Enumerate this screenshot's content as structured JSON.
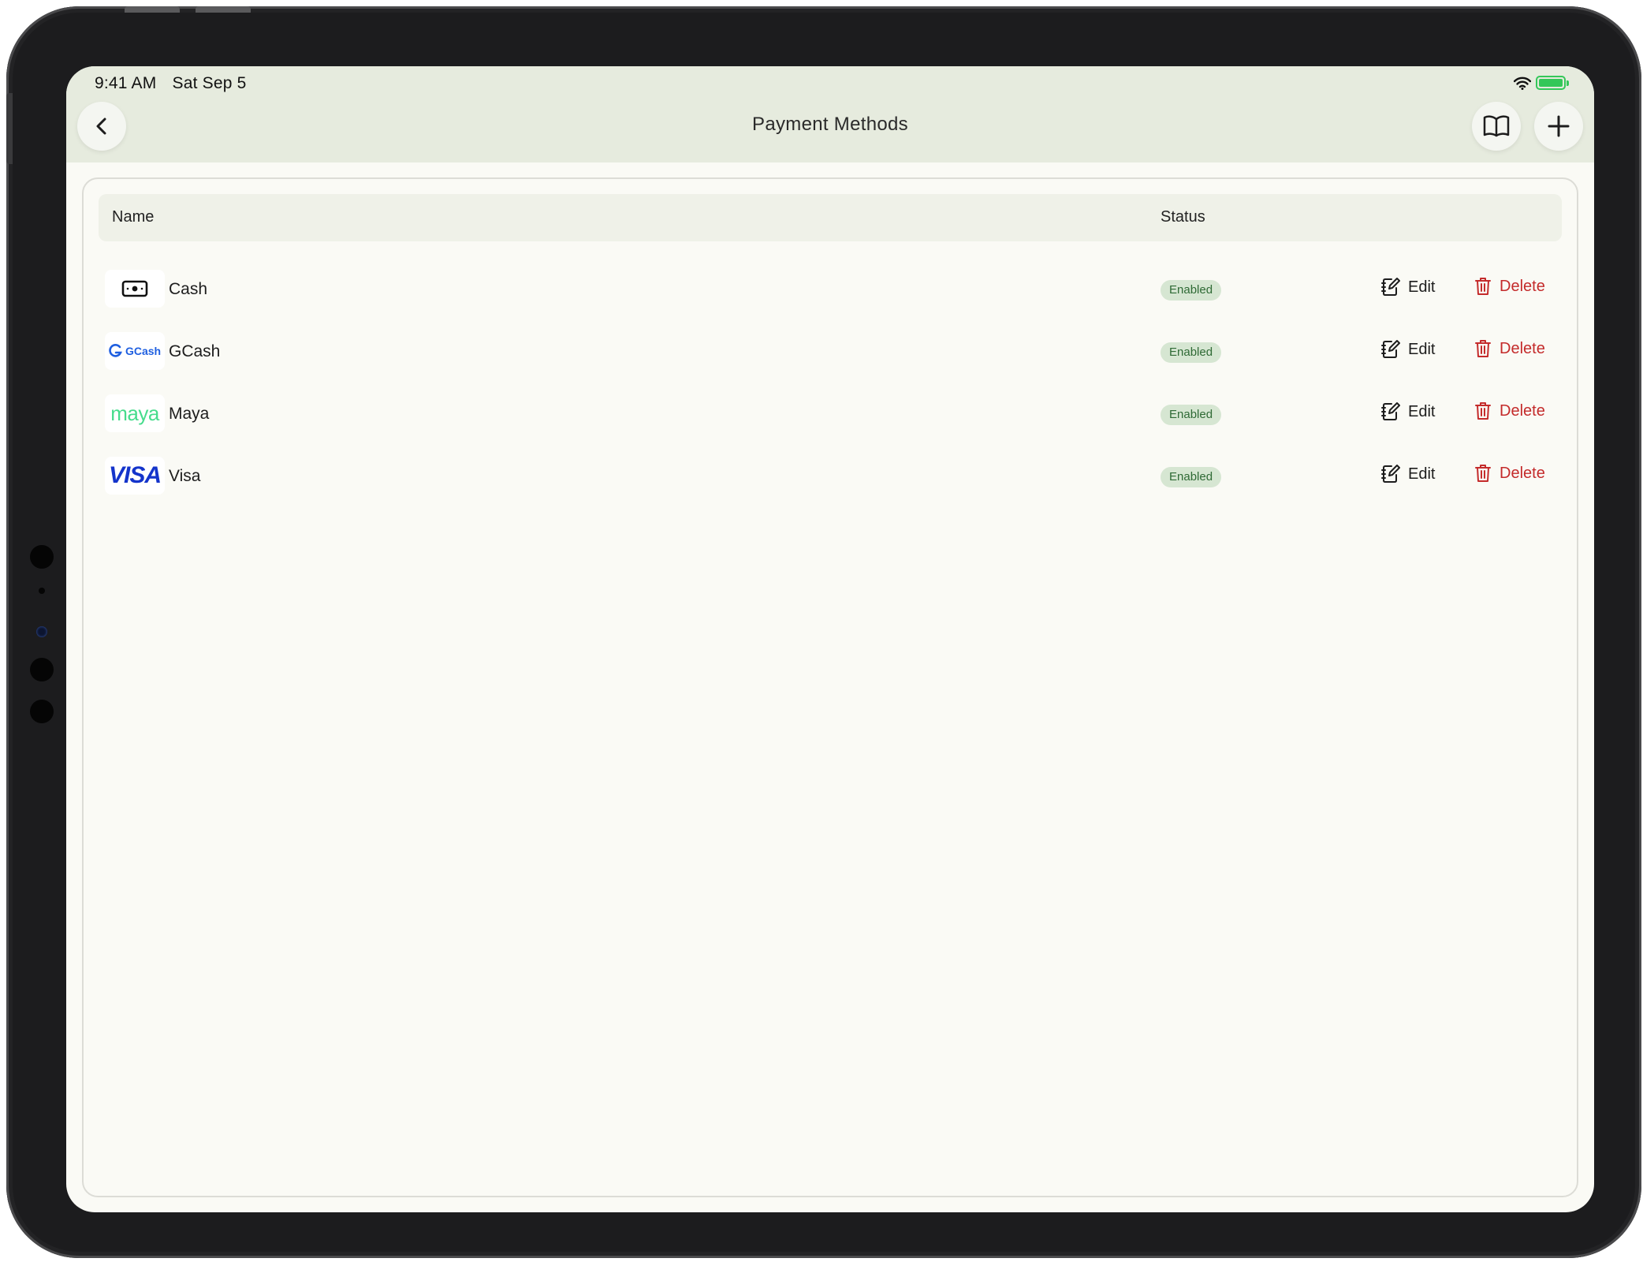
{
  "status_bar": {
    "time": "9:41 AM",
    "date": "Sat Sep 5"
  },
  "nav": {
    "title": "Payment Methods",
    "back_icon": "chevron-left-icon",
    "guide_icon": "book-icon",
    "add_icon": "plus-icon"
  },
  "table": {
    "headers": {
      "name": "Name",
      "status": "Status"
    },
    "rows": [
      {
        "name": "Cash",
        "logo": "cash-icon",
        "status": "Enabled",
        "edit": "Edit",
        "delete": "Delete"
      },
      {
        "name": "GCash",
        "logo": "GCash",
        "status": "Enabled",
        "edit": "Edit",
        "delete": "Delete"
      },
      {
        "name": "Maya",
        "logo": "maya",
        "status": "Enabled",
        "edit": "Edit",
        "delete": "Delete"
      },
      {
        "name": "Visa",
        "logo": "VISA",
        "status": "Enabled",
        "edit": "Edit",
        "delete": "Delete"
      }
    ]
  },
  "colors": {
    "topbar": "#e6ebde",
    "background": "#fafaf5",
    "badge_bg": "#d6e6d2",
    "badge_text": "#2f6a35",
    "delete": "#c42b2b",
    "gcash": "#1f5fe0",
    "maya": "#46dc8c",
    "visa": "#1434cb",
    "battery": "#34c759"
  }
}
